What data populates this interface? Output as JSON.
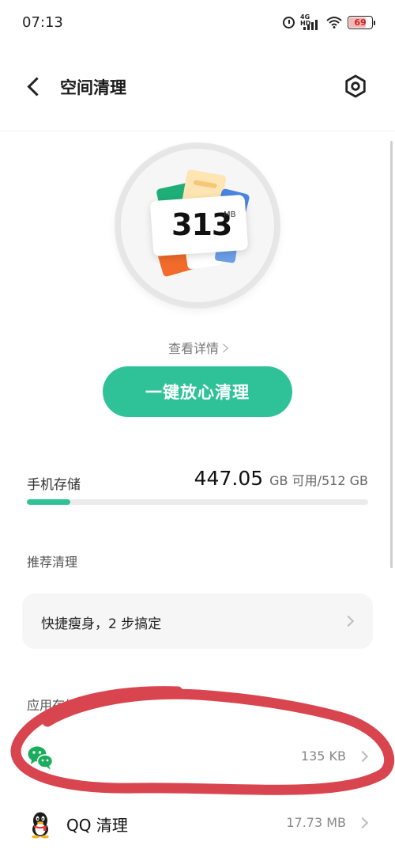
{
  "status_bar": {
    "time": "07:13",
    "network_label": "4G HD",
    "battery_level": "69",
    "battery_fraction": 0.69
  },
  "header": {
    "title": "空间清理",
    "back_icon": "chevron-left-icon",
    "settings_icon": "hexagon-gear-icon"
  },
  "cleanup": {
    "junk_size": "313",
    "junk_unit": "MB",
    "details_link": "查看详情",
    "clean_button": "一键放心清理"
  },
  "storage": {
    "label": "手机存储",
    "free_value": "447.05",
    "suffix": "GB 可用/512 GB",
    "used_fraction": 0.127
  },
  "recommend": {
    "heading": "推荐清理",
    "card_label": "快捷瘦身，2 步搞定"
  },
  "apps": {
    "heading": "应用存储",
    "items": [
      {
        "name": "",
        "size": "135 KB",
        "icon": "wechat-icon"
      },
      {
        "name": "QQ 清理",
        "size": "17.73 MB",
        "icon": "qq-penguin-icon"
      }
    ]
  },
  "colors": {
    "accent": "#2fc298",
    "annotation": "#d9454f"
  }
}
